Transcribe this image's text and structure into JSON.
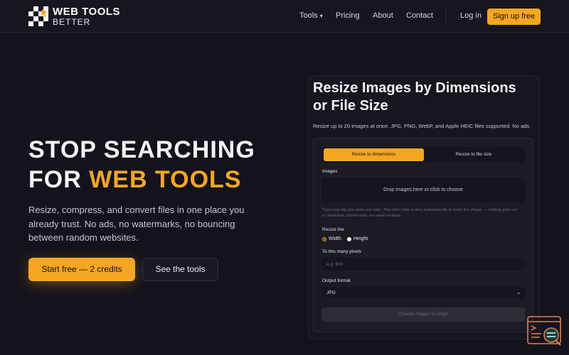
{
  "brand": {
    "line1": "WEB TOOLS",
    "line2": "BETTER"
  },
  "nav": {
    "tools": "Tools",
    "tools_caret": "▾",
    "pricing": "Pricing",
    "about": "About",
    "contact": "Contact",
    "login": "Log in",
    "signup": "Sign up free"
  },
  "hero": {
    "title_line1": "STOP SEARCHING",
    "title_line2_prefix": "FOR ",
    "title_line2_accent": "WEB TOOLS",
    "subtitle": "Resize, compress, and convert files in one place you already trust. No ads, no watermarks, no bouncing between random websites.",
    "primary_cta": "Start free — 2 credits",
    "secondary_cta": "See the tools"
  },
  "tool": {
    "title": "Resize Images by Dimensions or File Size",
    "description": "Resize up to 20 images at once. JPG, PNG, WebP, and Apple HEIC files supported. No ads.",
    "tabs": [
      {
        "label": "Resize to dimensions",
        "active": true
      },
      {
        "label": "Resize to file size",
        "active": false
      }
    ],
    "images_label": "Images",
    "dropzone": "Drop images here or click to choose",
    "help": "Type how big you want one side. The other side scales automatically to keep the shape — nothing gets cut or stretched. Shrink-only; we never enlarge.",
    "resize_label": "Resize the",
    "options": [
      {
        "label": "Width",
        "selected": true
      },
      {
        "label": "Height",
        "selected": false
      }
    ],
    "pixels_label": "To this many pixels",
    "pixels_placeholder": "e.g. 800",
    "format_label": "Output format",
    "format_value": "JPG",
    "format_caret": "⌄",
    "submit": "Choose images to begin"
  },
  "colors": {
    "accent": "#f5a623",
    "background": "#14121b",
    "panel": "#17151d"
  },
  "icons": {
    "logo": "checker-cube-cursor-logo",
    "float": "terminal-magnifier-icon"
  }
}
